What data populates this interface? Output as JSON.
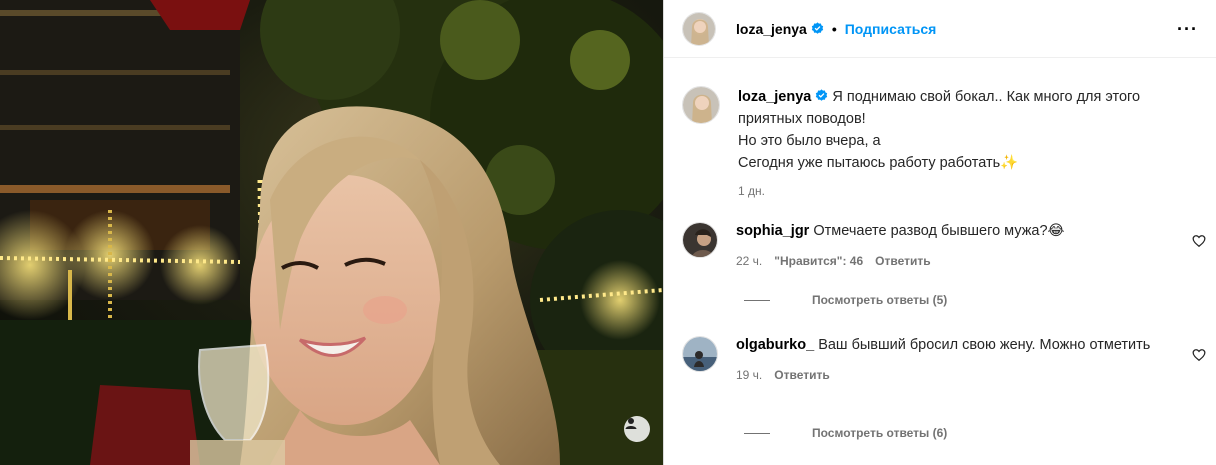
{
  "header": {
    "username": "loza_jenya",
    "follow_label": "Подписаться",
    "more_label": "···"
  },
  "caption": {
    "username": "loza_jenya",
    "line1": "Я поднимаю свой бокал.. Как много для этого приятных поводов!",
    "line2": "Но это было вчера, а",
    "line3": "Сегодня уже пытаюсь работу работать✨",
    "time": "1 дн."
  },
  "comments": [
    {
      "username": "sophia_jgr",
      "text": "Отмечаете развод бывшего мужа?😂",
      "time": "22 ч.",
      "likes": "\"Нравится\": 46",
      "reply_label": "Ответить",
      "view_replies": "Посмотреть ответы (5)"
    },
    {
      "username": "olgaburko_",
      "text": "Ваш бывший бросил свою жену. Можно отметить",
      "time": "19 ч.",
      "reply_label": "Ответить",
      "view_replies": "Посмотреть ответы (6)"
    }
  ],
  "colors": {
    "accent": "#0095f6",
    "secondary_text": "#737373",
    "verified": "#0095f6"
  },
  "icons": {
    "verified": "verified-badge-icon",
    "heart": "heart-outline-icon",
    "more": "more-horizontal-icon",
    "tag": "user-tag-icon"
  }
}
